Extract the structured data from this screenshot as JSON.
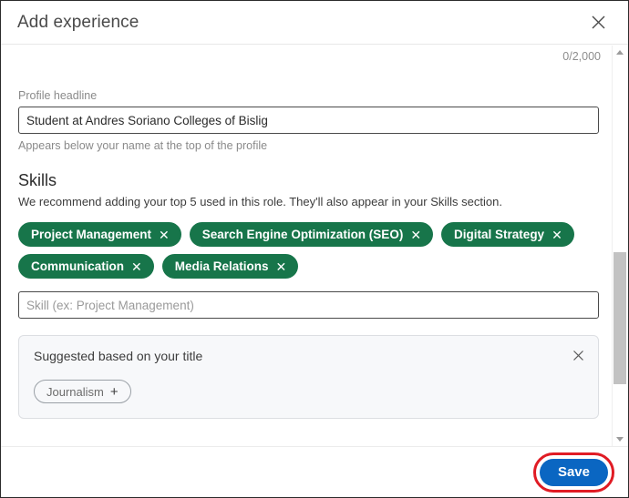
{
  "dialog": {
    "title": "Add experience",
    "close_icon": "close-icon",
    "char_counter": "0/2,000"
  },
  "profile_headline": {
    "label": "Profile headline",
    "value": "Student at Andres Soriano Colleges of Bislig",
    "placeholder": "",
    "hint": "Appears below your name at the top of the profile"
  },
  "skills": {
    "title": "Skills",
    "description": "We recommend adding your top 5 used in this role. They'll also appear in your Skills section.",
    "pills": [
      {
        "label": "Project Management",
        "remove_icon": "✕"
      },
      {
        "label": "Search Engine Optimization (SEO)",
        "remove_icon": "✕"
      },
      {
        "label": "Digital Strategy",
        "remove_icon": "✕"
      },
      {
        "label": "Communication",
        "remove_icon": "✕"
      },
      {
        "label": "Media Relations",
        "remove_icon": "✕"
      }
    ],
    "input_placeholder": "Skill (ex: Project Management)",
    "input_value": ""
  },
  "suggested": {
    "title": "Suggested based on your title",
    "close_icon": "close-icon",
    "chips": [
      {
        "label": "Journalism",
        "add_icon": "+"
      }
    ]
  },
  "footer": {
    "save_label": "Save"
  },
  "scrollbar": {
    "up_arrow": "chevron-up-icon",
    "down_arrow": "chevron-down-icon"
  },
  "colors": {
    "pill_green": "#17754a",
    "save_blue": "#0a66c2",
    "highlight_red": "#e01b24",
    "suggested_bg": "#f7f8fa"
  }
}
